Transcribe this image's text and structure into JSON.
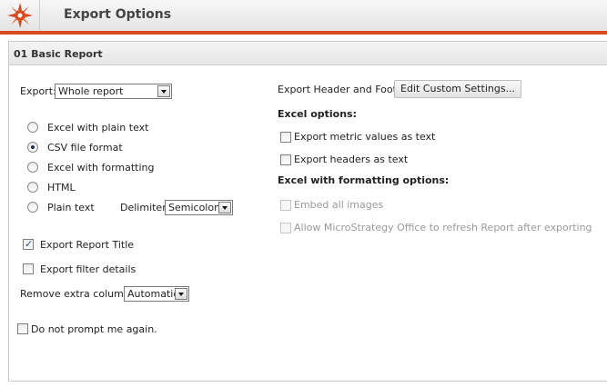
{
  "header": {
    "title": "Export Options",
    "accent_color": "#d9491e"
  },
  "panel": {
    "title": "01 Basic Report"
  },
  "export": {
    "label": "Export:",
    "selected": "Whole report"
  },
  "formats": [
    {
      "label": "Excel with plain text",
      "checked": false
    },
    {
      "label": "CSV file format",
      "checked": true
    },
    {
      "label": "Excel with formatting",
      "checked": false
    },
    {
      "label": "HTML",
      "checked": false
    },
    {
      "label": "Plain text",
      "checked": false
    }
  ],
  "delimiter": {
    "label": "Delimiter:",
    "selected": "Semicolon"
  },
  "options": {
    "report_title": {
      "label": "Export Report Title",
      "checked": true
    },
    "filter_details": {
      "label": "Export filter details",
      "checked": false
    }
  },
  "remove_column": {
    "label": "Remove extra column:",
    "selected": "Automatic"
  },
  "header_footer": {
    "label": "Export Header and Footer:",
    "button": "Edit Custom Settings..."
  },
  "excel_options": {
    "title": "Excel options:",
    "metric_values": "Export metric values as text",
    "headers": "Export headers as text"
  },
  "formatting_options": {
    "title": "Excel with formatting options:",
    "embed_images": "Embed all images",
    "allow_refresh": "Allow MicroStrategy Office to refresh Report after exporting"
  },
  "do_not_prompt": {
    "label": "Do not prompt me again.",
    "checked": false
  },
  "icons": {
    "logo": "microstrategy-logo-icon",
    "dropdown": "chevron-down-icon"
  }
}
